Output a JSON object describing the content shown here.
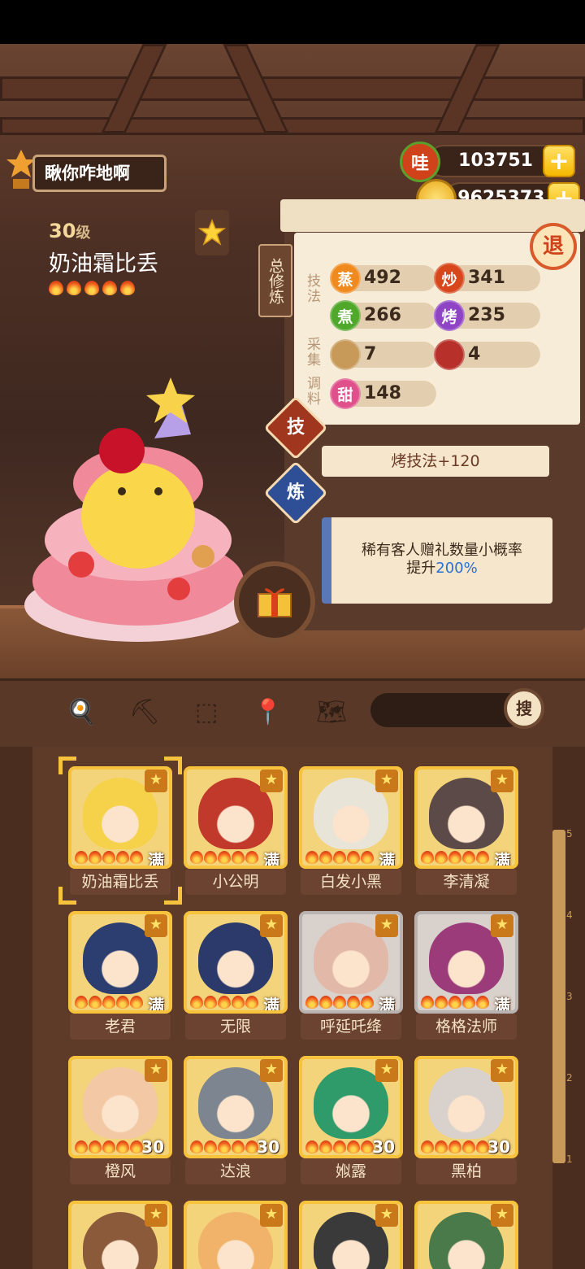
{
  "header": {
    "player_name": "瞅你咋地啊",
    "currency_wa_label": "哇",
    "currency_wa_value": "103751",
    "coins_value": "19625373",
    "plus_label": "+"
  },
  "character": {
    "level": "30",
    "level_unit": "级",
    "name": "奶油霜比丢",
    "flame_count": 5
  },
  "panel": {
    "side_label": "总修炼",
    "cat_technique": "技法",
    "cat_gather": "采集",
    "cat_season": "调料",
    "exit_label": "退",
    "stats": [
      {
        "icon": "蒸",
        "value": "492",
        "color": "#f08a1e"
      },
      {
        "icon": "炒",
        "value": "341",
        "color": "#d8461c"
      },
      {
        "icon": "煮",
        "value": "266",
        "color": "#4fa82a"
      },
      {
        "icon": "烤",
        "value": "235",
        "color": "#8e44c4"
      },
      {
        "icon": "",
        "value": "7",
        "color": "#c89a5a"
      },
      {
        "icon": "",
        "value": "4",
        "color": "#b8302a"
      },
      {
        "icon": "甜",
        "value": "148",
        "color": "#e0508a"
      }
    ],
    "tab_skill": "技",
    "tab_refine": "炼",
    "skill_text": "烤技法+120",
    "effect_line1": "稀有客人赠礼数量小概率",
    "effect_line2_prefix": "提升",
    "effect_line2_value": "200%"
  },
  "toolbar": {
    "search_label": "搜"
  },
  "cards": [
    {
      "name": "奶油霜比丢",
      "level": "满",
      "style": "gold",
      "selected": true,
      "color": "#f5d24a"
    },
    {
      "name": "小公明",
      "level": "满",
      "style": "gold",
      "selected": false,
      "color": "#c0392b"
    },
    {
      "name": "白发小黑",
      "level": "满",
      "style": "gold",
      "selected": false,
      "color": "#e9e4d8"
    },
    {
      "name": "李清凝",
      "level": "满",
      "style": "gold",
      "selected": false,
      "color": "#5c4a48"
    },
    {
      "name": "老君",
      "level": "满",
      "style": "gold",
      "selected": false,
      "color": "#2c3e70"
    },
    {
      "name": "无限",
      "level": "满",
      "style": "gold",
      "selected": false,
      "color": "#2b3a6a"
    },
    {
      "name": "呼延吒绛",
      "level": "满",
      "style": "gray",
      "selected": false,
      "color": "#e2b8a8"
    },
    {
      "name": "格格法师",
      "level": "满",
      "style": "gray",
      "selected": false,
      "color": "#9b3b7a"
    },
    {
      "name": "橙风",
      "level": "30",
      "style": "gold",
      "selected": false,
      "color": "#f2c9a4"
    },
    {
      "name": "达浪",
      "level": "30",
      "style": "gold",
      "selected": false,
      "color": "#7c8590"
    },
    {
      "name": "娰露",
      "level": "30",
      "style": "gold",
      "selected": false,
      "color": "#2f9a6a"
    },
    {
      "name": "黑柏",
      "level": "30",
      "style": "gold",
      "selected": false,
      "color": "#d9d2cc"
    },
    {
      "name": "",
      "level": "",
      "style": "gold",
      "selected": false,
      "color": "#8a5a3a"
    },
    {
      "name": "",
      "level": "",
      "style": "gold",
      "selected": false,
      "color": "#f1b36a"
    },
    {
      "name": "",
      "level": "",
      "style": "gold",
      "selected": false,
      "color": "#3a3a3a"
    },
    {
      "name": "",
      "level": "",
      "style": "gold",
      "selected": false,
      "color": "#4a7a4a"
    }
  ],
  "ruler_ticks": [
    "5",
    "4",
    "3",
    "2",
    "1"
  ]
}
